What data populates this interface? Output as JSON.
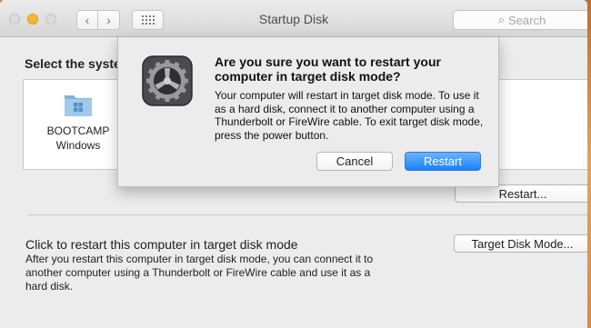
{
  "window": {
    "title": "Startup Disk",
    "search_placeholder": "Search"
  },
  "icons": {
    "back": "chevron-left",
    "forward": "chevron-right",
    "grid": "grid",
    "search": "magnifying-glass"
  },
  "main": {
    "select_label": "Select the system",
    "disks": [
      {
        "name_line1": "BOOTCAMP",
        "name_line2": "Windows",
        "icon": "folder-with-windows-logo"
      }
    ],
    "restart_button": "Restart...",
    "tdm_title": "Click to restart this computer in target disk mode",
    "tdm_desc": "After you restart this computer in target disk mode, you can connect it to another computer using a Thunderbolt or FireWire cable and use it as a hard disk.",
    "tdm_button": "Target Disk Mode..."
  },
  "dialog": {
    "heading": "Are you sure you want to restart your computer in target disk mode?",
    "body": "Your computer will restart in target disk mode. To use it as a hard disk, connect it to another computer using a Thunderbolt or FireWire cable. To exit target disk mode, press the power button.",
    "cancel_label": "Cancel",
    "restart_label": "Restart",
    "icon": "system-preferences-gear"
  },
  "colors": {
    "accent": "#1a82fb",
    "minimize": "#f5b82e"
  }
}
